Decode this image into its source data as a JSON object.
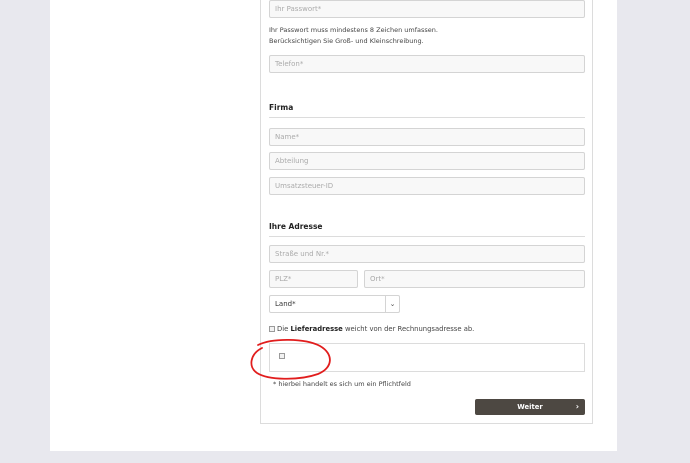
{
  "password": {
    "placeholder": "Ihr Passwort*",
    "hint_line1": "Ihr Passwort muss mindestens 8 Zeichen umfassen.",
    "hint_line2": "Berücksichtigen Sie Groß- und Kleinschreibung."
  },
  "phone": {
    "placeholder": "Telefon*"
  },
  "company": {
    "heading": "Firma",
    "name_placeholder": "Name*",
    "department_placeholder": "Abteilung",
    "vat_placeholder": "Umsatzsteuer-ID"
  },
  "address": {
    "heading": "Ihre Adresse",
    "street_placeholder": "Straße und Nr.*",
    "zip_placeholder": "PLZ*",
    "city_placeholder": "Ort*",
    "country_selected": "Land*",
    "arrow_icon": "chevron-down-icon"
  },
  "shipping": {
    "prefix": "Die ",
    "bold": "Lieferadresse",
    "suffix": " weicht von der Rechnungsadresse ab."
  },
  "required_note": "* hierbei handelt es sich um ein Pflichtfeld",
  "submit": {
    "label": "Weiter",
    "icon": "chevron-right-icon"
  },
  "colors": {
    "background": "#e8e8ee",
    "button": "#4d4842",
    "annotation": "#e11d1d"
  }
}
